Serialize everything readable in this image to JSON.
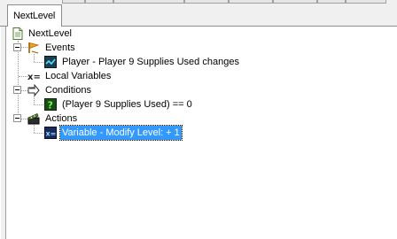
{
  "tabs": [
    {
      "label": "NextLevel",
      "active": true
    }
  ],
  "tree": {
    "root": {
      "label": "NextLevel",
      "icon": "document-icon"
    },
    "events": {
      "label": "Events",
      "icon": "flag-icon",
      "children": [
        {
          "label": "Player - Player 9 Supplies Used changes",
          "icon": "event-icon"
        }
      ]
    },
    "locals": {
      "label": "Local Variables",
      "icon": "variable-icon"
    },
    "conditions": {
      "label": "Conditions",
      "icon": "arrow-icon",
      "children": [
        {
          "label": "(Player 9 Supplies Used) == 0",
          "icon": "question-icon"
        }
      ]
    },
    "actions": {
      "label": "Actions",
      "icon": "clapper-icon",
      "children": [
        {
          "label": "Variable - Modify Level: + 1",
          "icon": "variable-icon",
          "selected": true
        }
      ]
    }
  },
  "colors": {
    "selection": "#3399ff",
    "tab_border": "#8c8c8c",
    "dotted_line": "#9a9a9a"
  }
}
